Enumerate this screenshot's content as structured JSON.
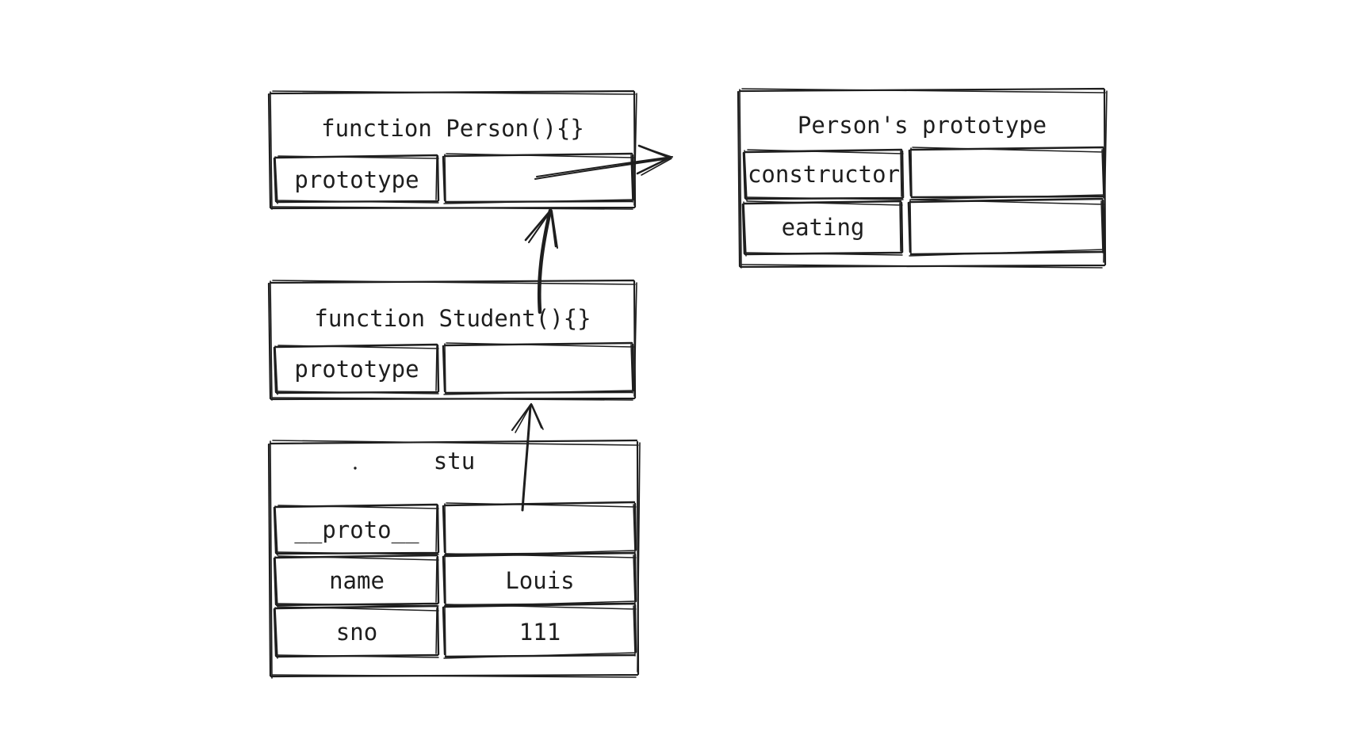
{
  "diagram": {
    "title_semantic": "javascript-prototype-chain-diagram",
    "stroke_color": "#1e1e1e",
    "background_color": "#ffffff",
    "nodes": [
      {
        "id": "person-function",
        "header": "function Person(){}",
        "rows": [
          {
            "key": "prototype",
            "value": ""
          }
        ]
      },
      {
        "id": "person-prototype",
        "header": "Person's prototype",
        "rows": [
          {
            "key": "constructor",
            "value": ""
          },
          {
            "key": "eating",
            "value": ""
          }
        ]
      },
      {
        "id": "student-function",
        "header": "function Student(){}",
        "rows": [
          {
            "key": "prototype",
            "value": ""
          }
        ]
      },
      {
        "id": "stu-object",
        "header": "stu",
        "rows": [
          {
            "key": "__proto__",
            "value": ""
          },
          {
            "key": "name",
            "value": "Louis"
          },
          {
            "key": "sno",
            "value": "111"
          }
        ]
      }
    ],
    "edges": [
      {
        "id": "person-prototype-edge",
        "from": "person-function.prototype-value",
        "to": "person-prototype",
        "label": ""
      },
      {
        "id": "student-proto-to-person-edge",
        "from": "student-function.header",
        "to": "person-function.prototype-value",
        "label": ""
      },
      {
        "id": "stu-proto-to-student-edge",
        "from": "stu-object.proto-value",
        "to": "student-function.prototype-value",
        "label": ""
      }
    ]
  }
}
